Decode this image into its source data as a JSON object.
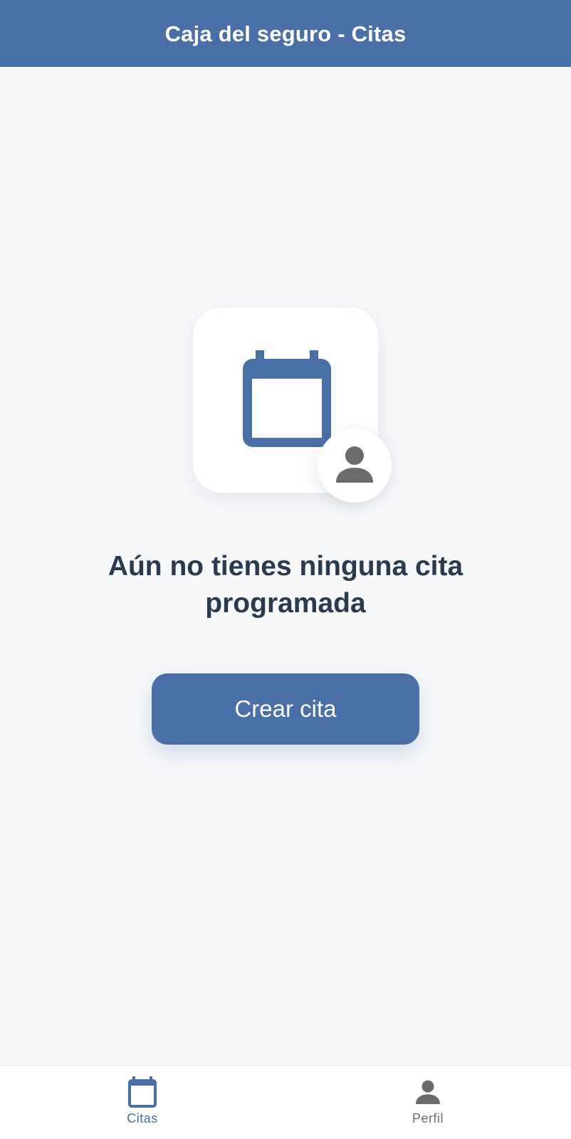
{
  "header": {
    "title": "Caja del seguro - Citas"
  },
  "empty_state": {
    "calendar_icon": "calendar-icon",
    "person_icon": "person-icon",
    "message": "Aún no tienes ninguna cita programada",
    "create_button_label": "Crear cita"
  },
  "tabs": [
    {
      "label": "Citas",
      "icon": "calendar-icon",
      "active": true
    },
    {
      "label": "Perfil",
      "icon": "person-icon",
      "active": false
    }
  ],
  "colors": {
    "primary": "#4a6ea6",
    "background": "#f7f8fa",
    "text_dark": "#2b3a4e",
    "icon_gray": "#6b6b6b"
  }
}
